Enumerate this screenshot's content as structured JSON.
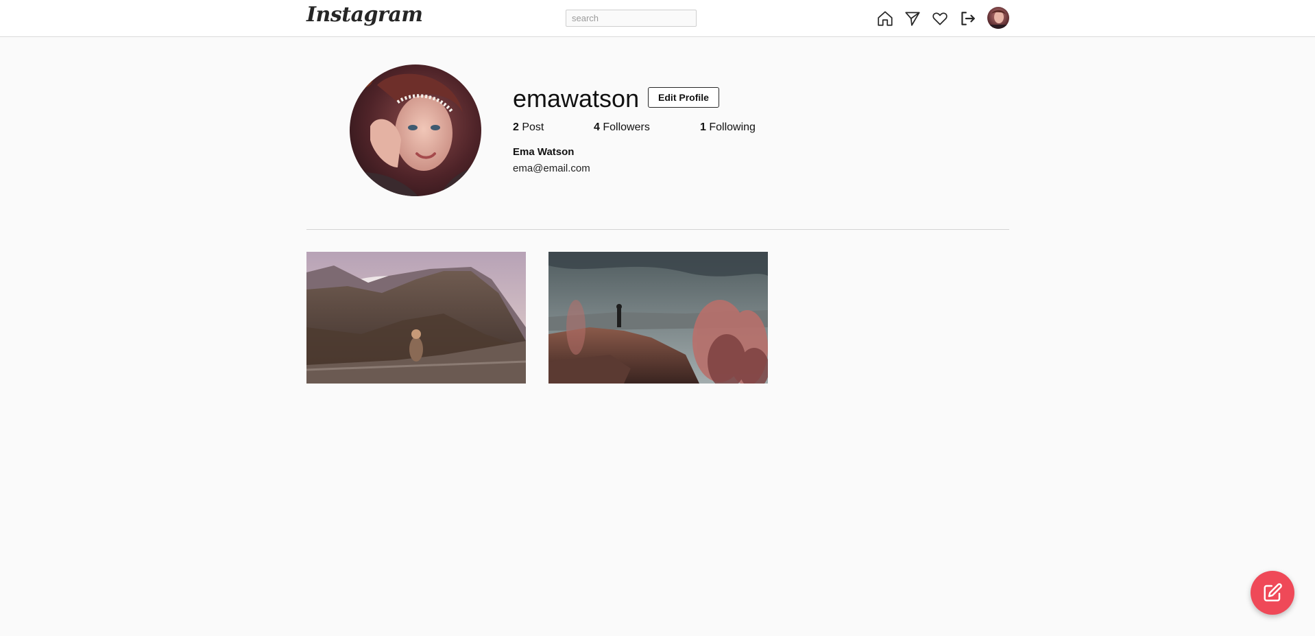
{
  "header": {
    "logo_text": "Instagram",
    "search_placeholder": "search",
    "icons": [
      "home-icon",
      "send-icon",
      "heart-icon",
      "logout-icon"
    ]
  },
  "profile": {
    "username": "emawatson",
    "edit_button_label": "Edit Profile",
    "stats": {
      "posts_count": "2",
      "posts_label": "Post",
      "followers_count": "4",
      "followers_label": "Followers",
      "following_count": "1",
      "following_label": "Following"
    },
    "full_name": "Ema Watson",
    "email": "ema@email.com"
  },
  "posts": [
    {
      "image": "mountain-cliff-woman-photo"
    },
    {
      "image": "hiker-on-rock-photo"
    }
  ],
  "fab": {
    "icon": "edit-icon"
  },
  "colors": {
    "accent": "#ef4958",
    "background": "#fafafa",
    "border": "#dbdbdb"
  }
}
